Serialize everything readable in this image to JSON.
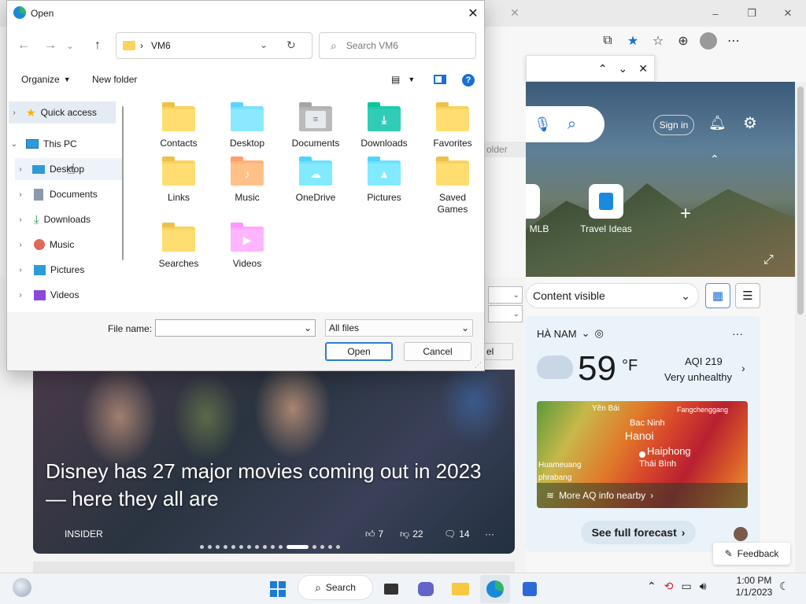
{
  "browser": {
    "window_controls": {
      "minimize": "–",
      "restore": "❐",
      "close": "✕"
    },
    "findbar": {
      "up": "⌃",
      "down": "⌄",
      "close": "✕"
    },
    "signin_label": "Sign in",
    "tiles": [
      {
        "label": "MLB"
      },
      {
        "label": "Travel Ideas"
      }
    ],
    "folder_partial": "older",
    "cancel_partial": "el",
    "content_visible_label": "Content visible",
    "weather": {
      "location": "HÀ NAM",
      "temperature": "59",
      "unit": "°F",
      "aqi": "AQI 219",
      "aqi_status": "Very unhealthy",
      "map_labels": [
        "Yên Bái",
        "Bac Ninh",
        "Fangchenggang",
        "Hanoi",
        "Haiphong",
        "Huameuang",
        "Thái Bình",
        "phrabang"
      ],
      "aq_link": "More AQ info nearby",
      "forecast_button": "See full forecast"
    },
    "news": {
      "headline": "Disney has 27 major movies coming out in 2023 — here they all are",
      "source": "INSIDER",
      "likes": "7",
      "dislikes": "22",
      "comments": "14",
      "more": "···"
    },
    "feedback_label": "Feedback"
  },
  "dialog": {
    "title": "Open",
    "close": "✕",
    "address": {
      "path_sep": "›",
      "folder": "VM6"
    },
    "search_placeholder": "Search VM6",
    "organize_label": "Organize",
    "new_folder_label": "New folder",
    "help": "?",
    "nav_items": [
      {
        "label": "Quick access"
      },
      {
        "label": "This PC"
      },
      {
        "label": "Desktop"
      },
      {
        "label": "Documents"
      },
      {
        "label": "Downloads"
      },
      {
        "label": "Music"
      },
      {
        "label": "Pictures"
      },
      {
        "label": "Videos"
      }
    ],
    "items": [
      {
        "label": "Contacts",
        "icon": "folder"
      },
      {
        "label": "Desktop",
        "icon": "desktop"
      },
      {
        "label": "Documents",
        "icon": "documents"
      },
      {
        "label": "Downloads",
        "icon": "downloads"
      },
      {
        "label": "Favorites",
        "icon": "folder"
      },
      {
        "label": "Links",
        "icon": "folder"
      },
      {
        "label": "Music",
        "icon": "music"
      },
      {
        "label": "OneDrive",
        "icon": "onedrive"
      },
      {
        "label": "Pictures",
        "icon": "pictures"
      },
      {
        "label": "Saved Games",
        "icon": "folder"
      },
      {
        "label": "Searches",
        "icon": "folder"
      },
      {
        "label": "Videos",
        "icon": "videos"
      }
    ],
    "file_name_label": "File name:",
    "file_name_value": "",
    "file_type": "All files",
    "open_button": "Open",
    "cancel_button": "Cancel"
  },
  "taskbar": {
    "search_label": "Search",
    "time": "1:00 PM",
    "date": "1/1/2023"
  }
}
